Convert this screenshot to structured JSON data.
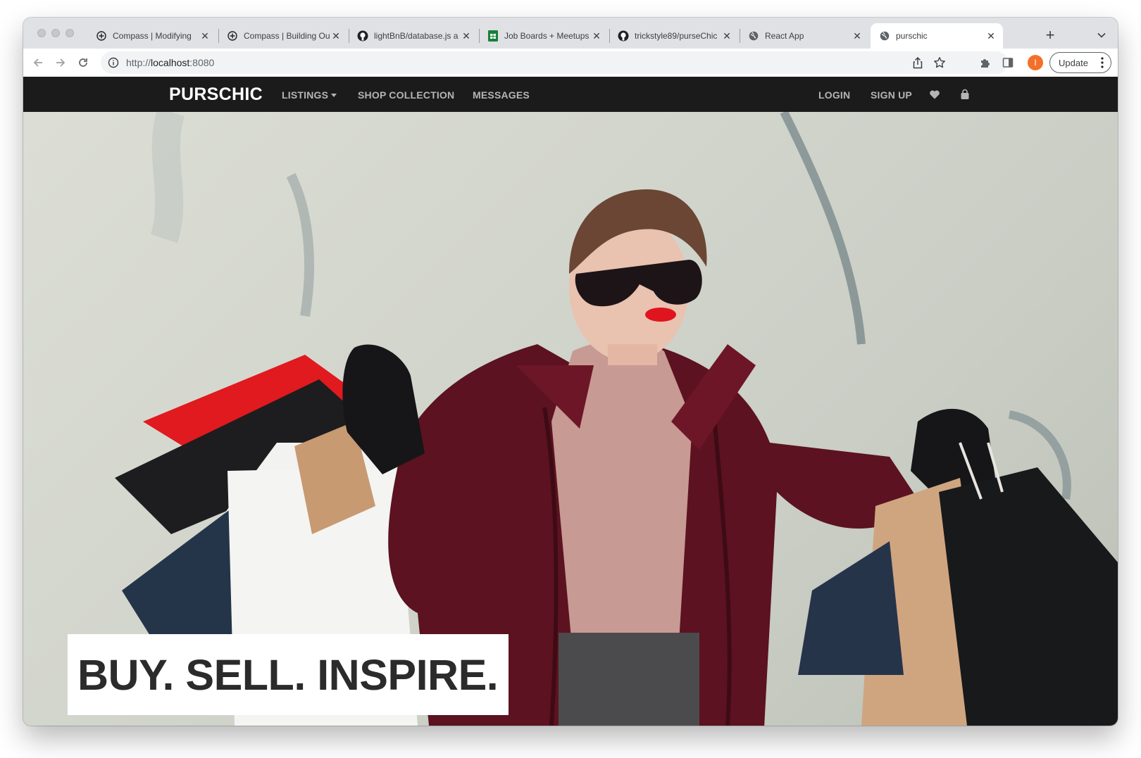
{
  "browser": {
    "tabs": [
      {
        "title": "Compass | Modifying",
        "favicon": "compass-icon",
        "active": false
      },
      {
        "title": "Compass | Building Ou",
        "favicon": "compass-icon",
        "active": false
      },
      {
        "title": "lightBnB/database.js a",
        "favicon": "github-icon",
        "active": false
      },
      {
        "title": "Job Boards + Meetups",
        "favicon": "sheets-icon",
        "active": false
      },
      {
        "title": "trickstyle89/purseChic",
        "favicon": "github-icon",
        "active": false
      },
      {
        "title": "React App",
        "favicon": "globe-icon",
        "active": false
      },
      {
        "title": "purschic",
        "favicon": "globe-icon",
        "active": true
      }
    ],
    "address": {
      "scheme": "http://",
      "host": "localhost",
      "port": ":8080"
    },
    "profile_initial": "I",
    "update_label": "Update",
    "colors": {
      "profile": "#f4702a",
      "tab_strip": "#dfe1e5"
    }
  },
  "site": {
    "brand": "PURSCHIC",
    "nav_left": [
      {
        "label": "LISTINGS",
        "has_dropdown": true
      },
      {
        "label": "SHOP COLLECTION",
        "has_dropdown": false
      },
      {
        "label": "MESSAGES",
        "has_dropdown": false
      }
    ],
    "nav_right": [
      {
        "label": "LOGIN"
      },
      {
        "label": "SIGN UP"
      }
    ],
    "nav_icons": [
      "heart-icon",
      "shopping-bag-icon"
    ],
    "hero": {
      "tagline": "BUY. SELL. INSPIRE.",
      "image": "woman-with-shopping-bags-photo"
    },
    "colors": {
      "nav_bg": "#1b1b1b",
      "nav_text": "#b5b5b5",
      "brand_text": "#ffffff",
      "coat": "#5c1220",
      "lips": "#e0141e"
    }
  }
}
